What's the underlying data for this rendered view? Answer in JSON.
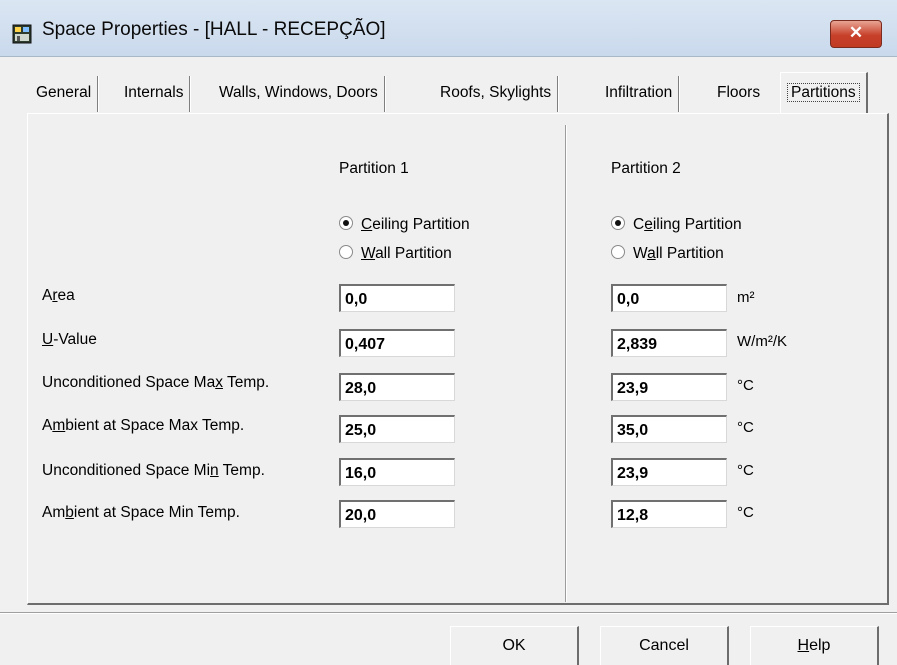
{
  "window": {
    "title": "Space Properties - [HALL - RECEPÇÃO]",
    "close_glyph": "✕"
  },
  "tabs": [
    {
      "label": "General"
    },
    {
      "label": "Internals"
    },
    {
      "label": "Walls, Windows, Doors"
    },
    {
      "label": "Roofs, Skylights"
    },
    {
      "label": "Infiltration"
    },
    {
      "label": "Floors"
    },
    {
      "label": "Partitions",
      "active": true
    }
  ],
  "partition1": {
    "header": "Partition 1",
    "ceiling_label_pre": "",
    "ceiling_label_key": "C",
    "ceiling_label_post": "eiling Partition",
    "wall_label_pre": "",
    "wall_label_key": "W",
    "wall_label_post": "all Partition",
    "selected": "ceiling",
    "values": [
      "0,0",
      "0,407",
      "28,0",
      "25,0",
      "16,0",
      "20,0"
    ]
  },
  "partition2": {
    "header": "Partition 2",
    "ceiling_label_pre": "C",
    "ceiling_label_key": "e",
    "ceiling_label_post": "iling Partition",
    "wall_label_pre": "W",
    "wall_label_key": "a",
    "wall_label_post": "ll Partition",
    "selected": "ceiling",
    "values": [
      "0,0",
      "2,839",
      "23,9",
      "35,0",
      "23,9",
      "12,8"
    ]
  },
  "rows": [
    {
      "pre": "A",
      "key": "r",
      "post": "ea",
      "unit": "m²"
    },
    {
      "pre": "",
      "key": "U",
      "post": "-Value",
      "unit": "W/m²/K"
    },
    {
      "pre": "Unconditioned Space Ma",
      "key": "x",
      "post": " Temp.",
      "unit": "°C"
    },
    {
      "pre": "A",
      "key": "m",
      "post": "bient at Space Max Temp.",
      "unit": "°C"
    },
    {
      "pre": "Unconditioned Space Mi",
      "key": "n",
      "post": " Temp.",
      "unit": "°C"
    },
    {
      "pre": "Am",
      "key": "b",
      "post": "ient at Space Min Temp.",
      "unit": "°C"
    }
  ],
  "buttons": {
    "ok": "OK",
    "cancel": "Cancel",
    "help_pre": "",
    "help_key": "H",
    "help_post": "elp"
  }
}
